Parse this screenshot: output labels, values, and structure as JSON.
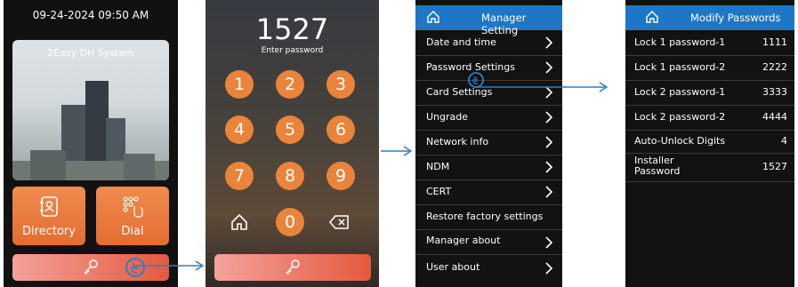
{
  "home": {
    "datetime": "09-24-2024 09:50 AM",
    "system_name": "2Easy DH System",
    "tiles": [
      {
        "label": "Directory"
      },
      {
        "label": "Dial"
      }
    ]
  },
  "keypad": {
    "code": "1527",
    "hint": "Enter password",
    "keys": [
      "1",
      "2",
      "3",
      "4",
      "5",
      "6",
      "7",
      "8",
      "9",
      "0"
    ]
  },
  "manager": {
    "title": "Manager Setting",
    "items": [
      {
        "label": "Date and time"
      },
      {
        "label": "Password Settings"
      },
      {
        "label": "Card Settings"
      },
      {
        "label": "Ungrade"
      },
      {
        "label": "Network info"
      },
      {
        "label": "NDM"
      },
      {
        "label": "CERT"
      },
      {
        "label": "Restore factory settings"
      },
      {
        "label": "Manager about"
      },
      {
        "label": "User about"
      }
    ]
  },
  "passwords": {
    "title": "Modify Passwords",
    "items": [
      {
        "label": "Lock 1 password-1",
        "value": "1111"
      },
      {
        "label": "Lock 1 password-2",
        "value": "2222"
      },
      {
        "label": "Lock 2 password-1",
        "value": "3333"
      },
      {
        "label": "Lock 2 password-2",
        "value": "4444"
      },
      {
        "label": "Auto-Unlock Digits",
        "value": "4"
      },
      {
        "label": "Installer Password",
        "value": "1527"
      }
    ]
  },
  "colors": {
    "accent": "#e9843a",
    "header_blue": "#1d77c6",
    "arrow_blue": "#2f7fc4"
  }
}
